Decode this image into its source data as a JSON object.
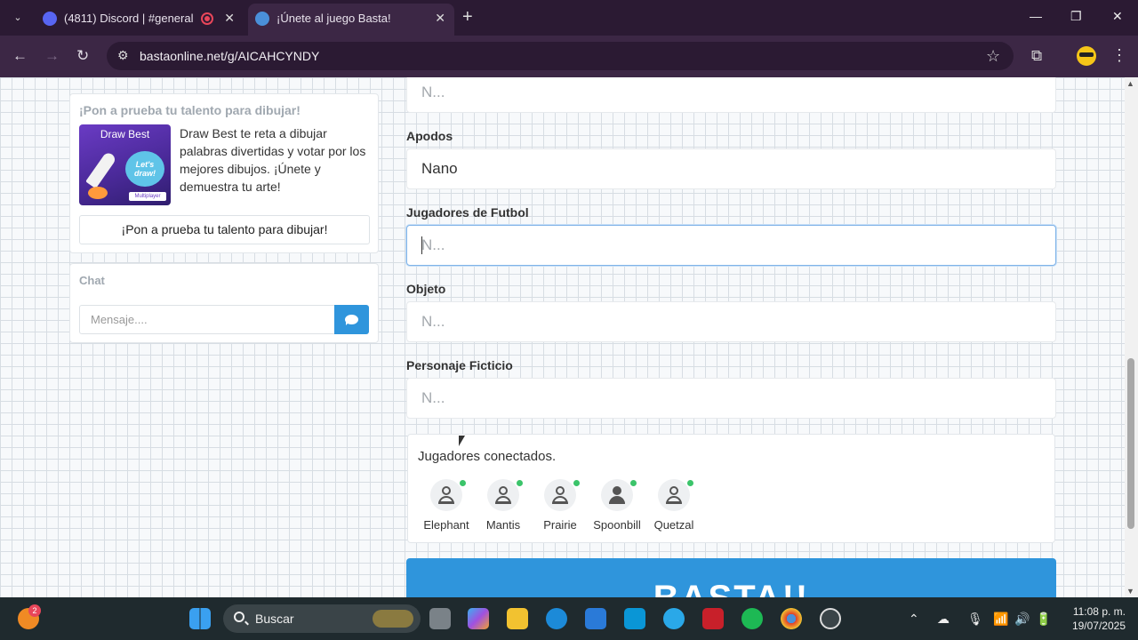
{
  "browser": {
    "tabs": [
      {
        "title": "(4811) Discord | #general |",
        "active": false
      },
      {
        "title": "¡Únete al juego Basta!",
        "active": true
      }
    ],
    "url": "bastaonline.net/g/AICAHCYNDY"
  },
  "promo": {
    "heading": "¡Pon a prueba tu talento para dibujar!",
    "image_title": "Draw Best",
    "image_bubble": "Let's draw!",
    "image_badge": "Multiplayer",
    "description": "Draw Best te reta a dibujar palabras divertidas y votar por los mejores dibujos. ¡Únete y demuestra tu arte!",
    "button_label": "¡Pon a prueba tu talento para dibujar!"
  },
  "chat": {
    "heading": "Chat",
    "input_placeholder": "Mensaje...."
  },
  "form": {
    "top_field_placeholder": "N...",
    "fields": [
      {
        "label": "Apodos",
        "value": "Nano",
        "placeholder": ""
      },
      {
        "label": "Jugadores de Futbol",
        "value": "",
        "placeholder": "N..."
      },
      {
        "label": "Objeto",
        "value": "",
        "placeholder": "N..."
      },
      {
        "label": "Personaje Ficticio",
        "value": "",
        "placeholder": "N..."
      }
    ]
  },
  "players": {
    "title": "Jugadores conectados.",
    "list": [
      {
        "name": "Elephant",
        "online": true,
        "host": false
      },
      {
        "name": "Mantis",
        "online": true,
        "host": false
      },
      {
        "name": "Prairie",
        "online": true,
        "host": false
      },
      {
        "name": "Spoonbill",
        "online": true,
        "host": true
      },
      {
        "name": "Quetzal",
        "online": true,
        "host": false
      }
    ]
  },
  "basta_button": "BASTA!!",
  "taskbar": {
    "search_placeholder": "Buscar",
    "notification_count": "2",
    "time": "11:08 p. m.",
    "date": "19/07/2025"
  },
  "colors": {
    "accent": "#2f95dc",
    "online": "#3bc46a",
    "chrome": "#3c2745"
  }
}
